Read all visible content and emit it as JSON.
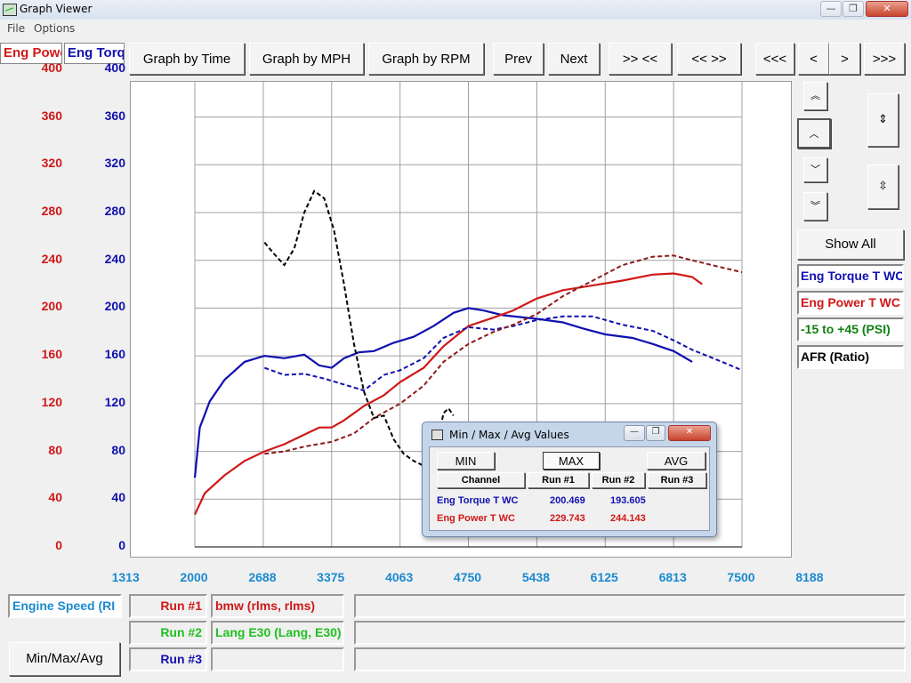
{
  "window": {
    "title": "Graph Viewer",
    "min_glyph": "—",
    "max_glyph": "❐",
    "close_glyph": "✕"
  },
  "menu": [
    "File",
    "Options"
  ],
  "channel_headers": {
    "left": "Eng Powe",
    "right": "Eng Torq"
  },
  "toolbar": {
    "graph_by_time": "Graph by Time",
    "graph_by_mph": "Graph by MPH",
    "graph_by_rpm": "Graph by RPM",
    "prev": "Prev",
    "next": "Next",
    "zoom_in": ">> <<",
    "zoom_out": "<< >>",
    "pan_far_left": "<<<",
    "pan_left": "<",
    "pan_right": ">",
    "pan_far_right": ">>>"
  },
  "colors": {
    "power": "#d01818",
    "torque": "#1010b0",
    "boost": "#108010",
    "afr": "#000000",
    "axis_x": "#1a8ad0"
  },
  "side_panel": {
    "show_all": "Show All",
    "channels": [
      {
        "label": "Eng Torque T WC",
        "color": "#1010b0"
      },
      {
        "label": "Eng Power T WC",
        "color": "#d01818"
      },
      {
        "label": "-15 to +45 (PSI)",
        "color": "#108010"
      },
      {
        "label": "AFR (Ratio)",
        "color": "#000000"
      }
    ]
  },
  "bottom": {
    "x_channel": "Engine Speed (RI",
    "runs": [
      {
        "label": "Run #1",
        "name": "bmw (rlms, rlms)",
        "color": "#d01818"
      },
      {
        "label": "Run #2",
        "name": "Lang E30 (Lang, E30)",
        "color": "#20c020"
      },
      {
        "label": "Run #3",
        "name": "",
        "color": "#1010b0"
      }
    ],
    "minmax_button": "Min/Max/Avg"
  },
  "dialog": {
    "title": "Min / Max / Avg Values",
    "buttons": {
      "min": "MIN",
      "max": "MAX",
      "avg": "AVG"
    },
    "headers": [
      "Channel",
      "Run #1",
      "Run #2",
      "Run #3"
    ],
    "rows": [
      {
        "channel": "Eng Torque T WC",
        "run1": "200.469",
        "run2": "193.605",
        "run3": "",
        "color": "#1010b0"
      },
      {
        "channel": "Eng Power T WC",
        "run1": "229.743",
        "run2": "244.143",
        "run3": "",
        "color": "#d01818"
      }
    ]
  },
  "chart_data": {
    "type": "line",
    "xlabel": "Engine Speed (RI",
    "x_ticks": [
      "1313",
      "2000",
      "2688",
      "3375",
      "4063",
      "4750",
      "5438",
      "6125",
      "6813",
      "7500",
      "8188"
    ],
    "xlim": [
      1313,
      8188
    ],
    "left_axis": {
      "label": "Eng Powe",
      "ticks": [
        "400",
        "360",
        "320",
        "280",
        "240",
        "200",
        "160",
        "120",
        "80",
        "40",
        "0"
      ],
      "ylim": [
        0,
        400
      ]
    },
    "right_axis": {
      "label": "Eng Torq",
      "ticks": [
        "400",
        "360",
        "320",
        "280",
        "240",
        "200",
        "160",
        "120",
        "80",
        "40",
        "0"
      ],
      "ylim": [
        0,
        400
      ]
    },
    "grid": true,
    "series": [
      {
        "name": "Eng Torque T WC",
        "run": "Run #1",
        "color": "#1010b0",
        "dash": false,
        "points": [
          [
            2000,
            58
          ],
          [
            2050,
            100
          ],
          [
            2150,
            122
          ],
          [
            2300,
            140
          ],
          [
            2500,
            155
          ],
          [
            2700,
            160
          ],
          [
            2900,
            158
          ],
          [
            3100,
            161
          ],
          [
            3250,
            152
          ],
          [
            3375,
            150
          ],
          [
            3500,
            158
          ],
          [
            3650,
            163
          ],
          [
            3800,
            164
          ],
          [
            4000,
            171
          ],
          [
            4200,
            176
          ],
          [
            4400,
            185
          ],
          [
            4600,
            196
          ],
          [
            4750,
            200
          ],
          [
            4900,
            198
          ],
          [
            5100,
            194
          ],
          [
            5438,
            191
          ],
          [
            5700,
            188
          ],
          [
            5900,
            183
          ],
          [
            6125,
            178
          ],
          [
            6400,
            175
          ],
          [
            6600,
            170
          ],
          [
            6813,
            164
          ],
          [
            7000,
            155
          ]
        ]
      },
      {
        "name": "Eng Power T WC",
        "run": "Run #1",
        "color": "#d01818",
        "dash": false,
        "points": [
          [
            2000,
            27
          ],
          [
            2100,
            45
          ],
          [
            2300,
            60
          ],
          [
            2500,
            72
          ],
          [
            2700,
            80
          ],
          [
            2900,
            86
          ],
          [
            3100,
            94
          ],
          [
            3250,
            100
          ],
          [
            3375,
            100
          ],
          [
            3500,
            106
          ],
          [
            3700,
            118
          ],
          [
            3900,
            127
          ],
          [
            4063,
            138
          ],
          [
            4300,
            150
          ],
          [
            4500,
            168
          ],
          [
            4750,
            185
          ],
          [
            5000,
            192
          ],
          [
            5200,
            198
          ],
          [
            5438,
            208
          ],
          [
            5700,
            215
          ],
          [
            6000,
            219
          ],
          [
            6300,
            223
          ],
          [
            6600,
            228
          ],
          [
            6813,
            229
          ],
          [
            7000,
            226
          ],
          [
            7100,
            220
          ]
        ]
      },
      {
        "name": "Eng Torque T WC",
        "run": "Run #2",
        "color": "#1010b0",
        "dash": true,
        "points": [
          [
            2700,
            150
          ],
          [
            2900,
            144
          ],
          [
            3100,
            145
          ],
          [
            3300,
            141
          ],
          [
            3500,
            136
          ],
          [
            3700,
            131
          ],
          [
            3900,
            144
          ],
          [
            4063,
            148
          ],
          [
            4300,
            158
          ],
          [
            4500,
            175
          ],
          [
            4750,
            184
          ],
          [
            5000,
            182
          ],
          [
            5200,
            185
          ],
          [
            5438,
            190
          ],
          [
            5700,
            193
          ],
          [
            6000,
            193
          ],
          [
            6300,
            186
          ],
          [
            6600,
            181
          ],
          [
            6813,
            173
          ],
          [
            7000,
            165
          ],
          [
            7300,
            155
          ],
          [
            7500,
            148
          ]
        ]
      },
      {
        "name": "Eng Power T WC",
        "run": "Run #2",
        "color": "#8c1a1a",
        "dash": true,
        "points": [
          [
            2700,
            78
          ],
          [
            2900,
            80
          ],
          [
            3100,
            84
          ],
          [
            3375,
            88
          ],
          [
            3600,
            95
          ],
          [
            3800,
            108
          ],
          [
            4063,
            120
          ],
          [
            4300,
            135
          ],
          [
            4500,
            155
          ],
          [
            4750,
            170
          ],
          [
            5000,
            180
          ],
          [
            5200,
            186
          ],
          [
            5438,
            195
          ],
          [
            5700,
            210
          ],
          [
            6000,
            223
          ],
          [
            6300,
            236
          ],
          [
            6600,
            243
          ],
          [
            6813,
            244
          ],
          [
            7000,
            240
          ],
          [
            7300,
            234
          ],
          [
            7500,
            230
          ]
        ]
      },
      {
        "name": "AFR (Ratio)",
        "run": "Run #2",
        "color": "#000000",
        "dash": true,
        "points": [
          [
            2700,
            255
          ],
          [
            2800,
            245
          ],
          [
            2900,
            236
          ],
          [
            3000,
            250
          ],
          [
            3100,
            280
          ],
          [
            3200,
            298
          ],
          [
            3300,
            292
          ],
          [
            3400,
            265
          ],
          [
            3500,
            220
          ],
          [
            3600,
            170
          ],
          [
            3700,
            130
          ],
          [
            3800,
            108
          ],
          [
            3900,
            110
          ],
          [
            4000,
            90
          ],
          [
            4100,
            78
          ],
          [
            4200,
            72
          ],
          [
            4300,
            68
          ],
          [
            4400,
            76
          ],
          [
            4450,
            92
          ],
          [
            4500,
            112
          ],
          [
            4550,
            116
          ],
          [
            4600,
            110
          ]
        ]
      }
    ]
  }
}
